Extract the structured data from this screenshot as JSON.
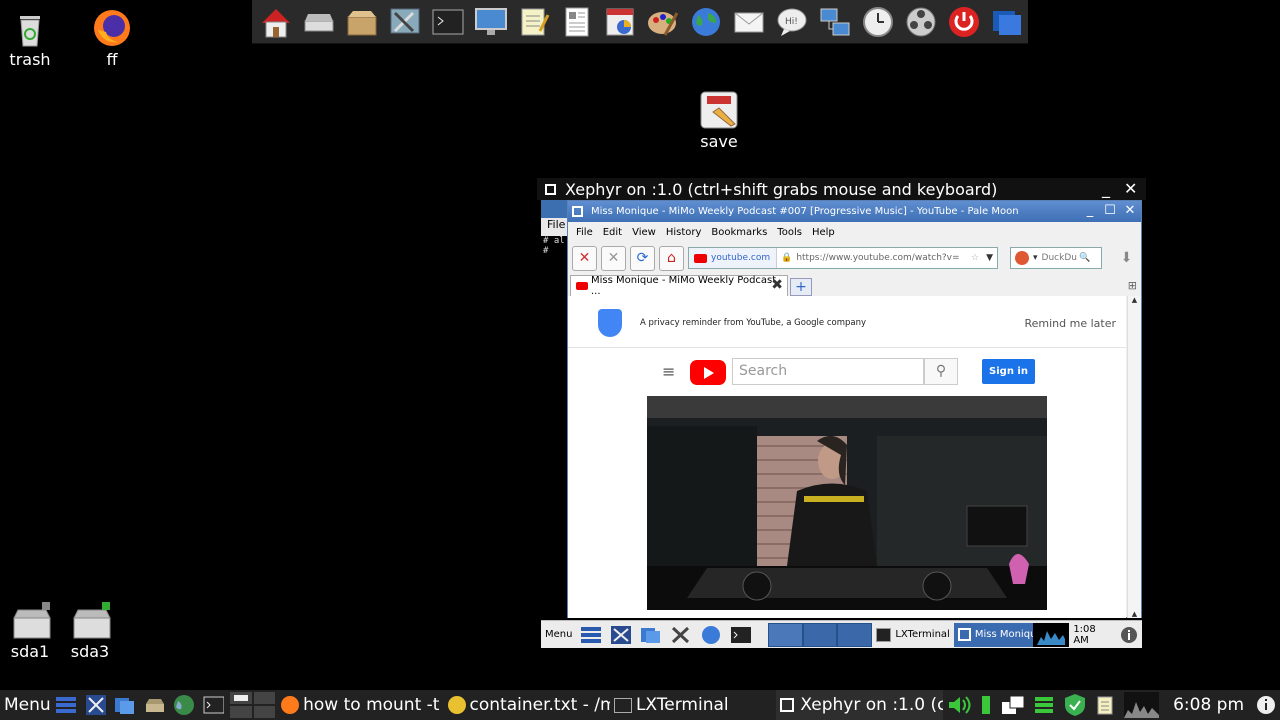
{
  "desktop": {
    "icons": [
      {
        "label": "trash"
      },
      {
        "label": "ff"
      },
      {
        "label": "save"
      },
      {
        "label": "sda1"
      },
      {
        "label": "sda3"
      }
    ]
  },
  "launcher": {
    "items": [
      "home-icon",
      "drive-icon",
      "package-icon",
      "settings-icon",
      "terminal-icon",
      "monitor-icon",
      "notepad-icon",
      "document-icon",
      "chart-icon",
      "paint-icon",
      "globe-icon",
      "mail-icon",
      "chat-icon",
      "network-icon",
      "clock-icon",
      "film-icon",
      "power-icon",
      "windows-icon"
    ]
  },
  "xephyr": {
    "title": "Xephyr on :1.0 (ctrl+shift grabs mouse and keyboard)",
    "min": "_",
    "close": "✕"
  },
  "lxterm_frag": {
    "menu": "File",
    "lines": [
      "# al",
      "#"
    ]
  },
  "palemoon": {
    "title": "Miss Monique - MiMo Weekly Podcast #007 [Progressive Music] - YouTube - Pale Moon",
    "menu": [
      "File",
      "Edit",
      "View",
      "History",
      "Bookmarks",
      "Tools",
      "Help"
    ],
    "site": "youtube.com",
    "url": "https://www.youtube.com/watch?v=",
    "search_placeholder": "DuckDu",
    "tab_label": "Miss Monique - MiMo Weekly Podcast ...",
    "ctl_min": "_",
    "ctl_max": "☐",
    "ctl_close": "✕"
  },
  "youtube": {
    "privacy_text": "A privacy reminder from YouTube, a Google company",
    "remind_later": "Remind me later",
    "search_placeholder": "Search",
    "sign_in": "Sign in"
  },
  "inner_panel": {
    "menu": "Menu",
    "lxterminal": "LXTerminal",
    "miss_monique": "Miss Moniqu",
    "clock": "1:08 AM"
  },
  "taskbar": {
    "menu": "Menu",
    "firefox_task": "how to mount -t",
    "container_task": "container.txt - /m",
    "lxterminal_task": "LXTerminal",
    "xephyr_task": "Xephyr on :1.0 (c",
    "clock": "6:08 pm"
  }
}
